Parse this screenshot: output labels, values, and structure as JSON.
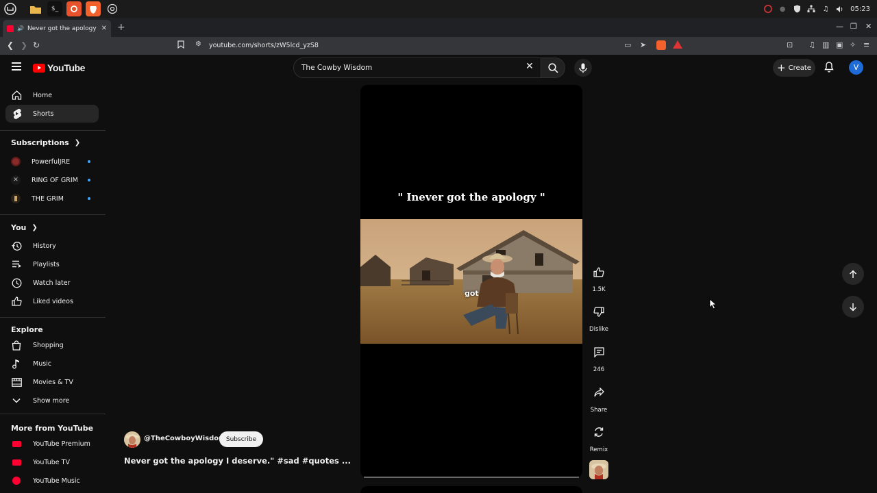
{
  "browser": {
    "tab_title": "Never got the apology I de",
    "url": "youtube.com/shorts/zW5lcd_yzS8"
  },
  "taskbar": {
    "clock": "05:23"
  },
  "header": {
    "logo_text": "YouTube",
    "search_value": "The Cowby Wisdom",
    "create_label": "Create",
    "avatar_letter": "V"
  },
  "sidebar": {
    "main": [
      {
        "label": "Home",
        "icon": "home-icon"
      },
      {
        "label": "Shorts",
        "icon": "shorts-icon"
      }
    ],
    "subscriptions_title": "Subscriptions",
    "subscriptions": [
      {
        "label": "PowerfulJRE",
        "color": "#8b2a2a"
      },
      {
        "label": "RING OF GRIM",
        "color": "#3a3a3a"
      },
      {
        "label": "THE GRIM",
        "color": "#5a4630"
      }
    ],
    "you_title": "You",
    "you": [
      {
        "label": "History",
        "icon": "history-icon"
      },
      {
        "label": "Playlists",
        "icon": "playlists-icon"
      },
      {
        "label": "Watch later",
        "icon": "watch-later-icon"
      },
      {
        "label": "Liked videos",
        "icon": "thumbs-up-icon"
      }
    ],
    "explore_title": "Explore",
    "explore": [
      {
        "label": "Shopping",
        "icon": "shopping-bag-icon"
      },
      {
        "label": "Music",
        "icon": "music-note-icon"
      },
      {
        "label": "Movies & TV",
        "icon": "film-icon"
      },
      {
        "label": "Show more",
        "icon": "chevron-down-icon"
      }
    ],
    "more_title": "More from YouTube",
    "more": [
      {
        "label": "YouTube Premium"
      },
      {
        "label": "YouTube TV"
      },
      {
        "label": "YouTube Music"
      }
    ]
  },
  "short": {
    "overlay_title": "\" Inever got the apology \"",
    "caption_word": "got",
    "channel": "@TheCowboyWisdom",
    "subscribe_label": "Subscribe",
    "description": "Never got the apology I deserve.\" #sad #quotes ..."
  },
  "actions": {
    "likes": "1.5K",
    "dislike": "Dislike",
    "comments": "246",
    "share": "Share",
    "remix": "Remix"
  },
  "colors": {
    "brand_red": "#ff0000",
    "accent_blue": "#3ea6ff",
    "background": "#0f0f0f"
  }
}
